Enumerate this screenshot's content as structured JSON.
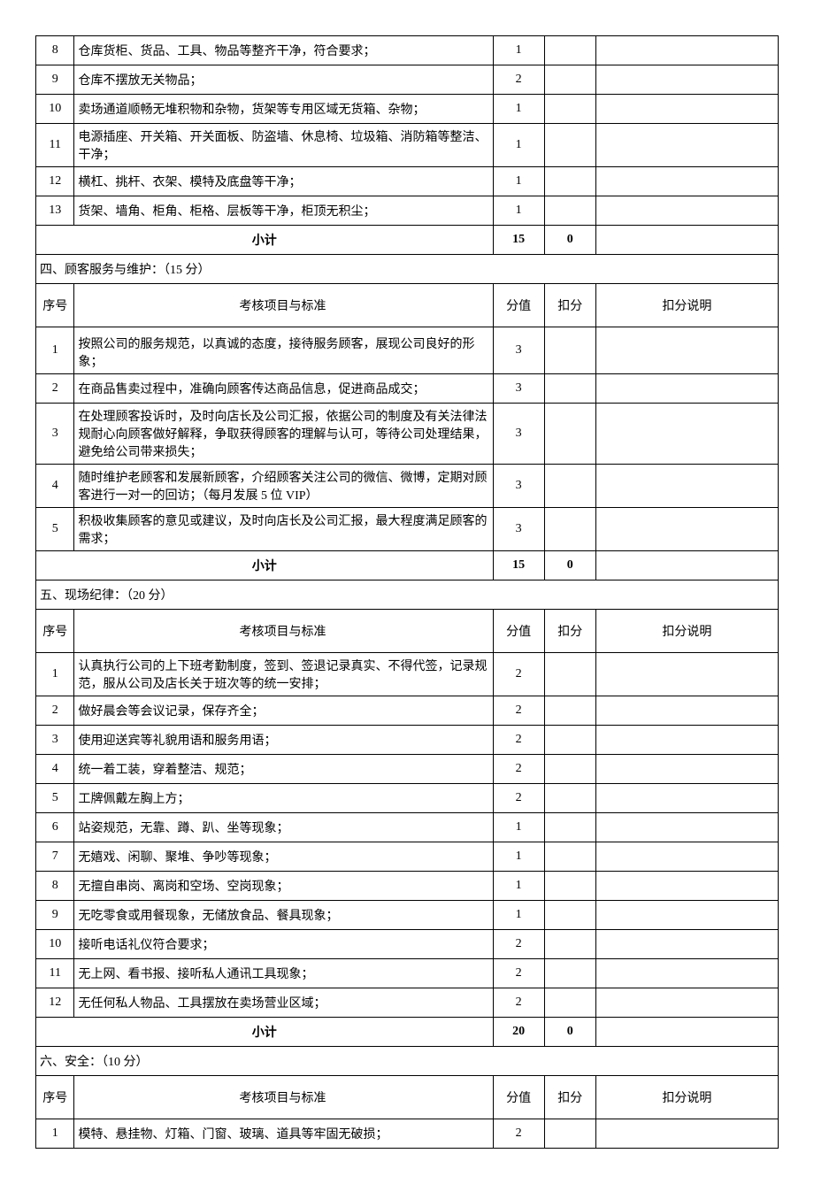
{
  "headers": {
    "seq": "序号",
    "criteria": "考核项目与标准",
    "score": "分值",
    "deduct": "扣分",
    "note": "扣分说明"
  },
  "subtotal_label": "小计",
  "section3_rows": [
    {
      "seq": "8",
      "criteria": "仓库货柜、货品、工具、物品等整齐干净，符合要求；",
      "score": "1"
    },
    {
      "seq": "9",
      "criteria": "仓库不摆放无关物品；",
      "score": "2"
    },
    {
      "seq": "10",
      "criteria": "卖场通道顺畅无堆积物和杂物，货架等专用区域无货箱、杂物；",
      "score": "1"
    },
    {
      "seq": "11",
      "criteria": "电源插座、开关箱、开关面板、防盗墙、休息椅、垃圾箱、消防箱等整洁、干净；",
      "score": "1"
    },
    {
      "seq": "12",
      "criteria": "横杠、挑杆、衣架、模特及底盘等干净；",
      "score": "1"
    },
    {
      "seq": "13",
      "criteria": "货架、墙角、柜角、柜格、层板等干净，柜顶无积尘；",
      "score": "1"
    }
  ],
  "section3_subtotal": {
    "score": "15",
    "deduct": "0"
  },
  "section4_title": "四、顾客服务与维护：（15 分）",
  "section4_rows": [
    {
      "seq": "1",
      "criteria": "按照公司的服务规范，以真诚的态度，接待服务顾客，展现公司良好的形象；",
      "score": "3"
    },
    {
      "seq": "2",
      "criteria": "在商品售卖过程中，准确向顾客传达商品信息，促进商品成交；",
      "score": "3"
    },
    {
      "seq": "3",
      "criteria": "在处理顾客投诉时，及时向店长及公司汇报，依据公司的制度及有关法律法规耐心向顾客做好解释，争取获得顾客的理解与认可，等待公司处理结果，避免给公司带来损失；",
      "score": "3"
    },
    {
      "seq": "4",
      "criteria": "随时维护老顾客和发展新顾客，介绍顾客关注公司的微信、微博，定期对顾客进行一对一的回访；（每月发展 5 位 VIP）",
      "score": "3"
    },
    {
      "seq": "5",
      "criteria": "积极收集顾客的意见或建议，及时向店长及公司汇报，最大程度满足顾客的需求；",
      "score": "3"
    }
  ],
  "section4_subtotal": {
    "score": "15",
    "deduct": "0"
  },
  "section5_title": "五、现场纪律：（20 分）",
  "section5_rows": [
    {
      "seq": "1",
      "criteria": "认真执行公司的上下班考勤制度，签到、签退记录真实、不得代签，记录规范，服从公司及店长关于班次等的统一安排；",
      "score": "2"
    },
    {
      "seq": "2",
      "criteria": "做好晨会等会议记录，保存齐全；",
      "score": "2"
    },
    {
      "seq": "3",
      "criteria": "使用迎送宾等礼貌用语和服务用语；",
      "score": "2"
    },
    {
      "seq": "4",
      "criteria": "统一着工装，穿着整洁、规范；",
      "score": "2"
    },
    {
      "seq": "5",
      "criteria": "工牌佩戴左胸上方；",
      "score": "2"
    },
    {
      "seq": "6",
      "criteria": "站姿规范，无靠、蹲、趴、坐等现象；",
      "score": "1"
    },
    {
      "seq": "7",
      "criteria": "无嬉戏、闲聊、聚堆、争吵等现象；",
      "score": "1"
    },
    {
      "seq": "8",
      "criteria": "无擅自串岗、离岗和空场、空岗现象；",
      "score": "1"
    },
    {
      "seq": "9",
      "criteria": "无吃零食或用餐现象，无储放食品、餐具现象；",
      "score": "1"
    },
    {
      "seq": "10",
      "criteria": "接听电话礼仪符合要求；",
      "score": "2"
    },
    {
      "seq": "11",
      "criteria": "无上网、看书报、接听私人通讯工具现象；",
      "score": "2"
    },
    {
      "seq": "12",
      "criteria": "无任何私人物品、工具摆放在卖场营业区域；",
      "score": "2"
    }
  ],
  "section5_subtotal": {
    "score": "20",
    "deduct": "0"
  },
  "section6_title": "六、安全：（10 分）",
  "section6_rows": [
    {
      "seq": "1",
      "criteria": "模特、悬挂物、灯箱、门窗、玻璃、道具等牢固无破损；",
      "score": "2"
    }
  ]
}
